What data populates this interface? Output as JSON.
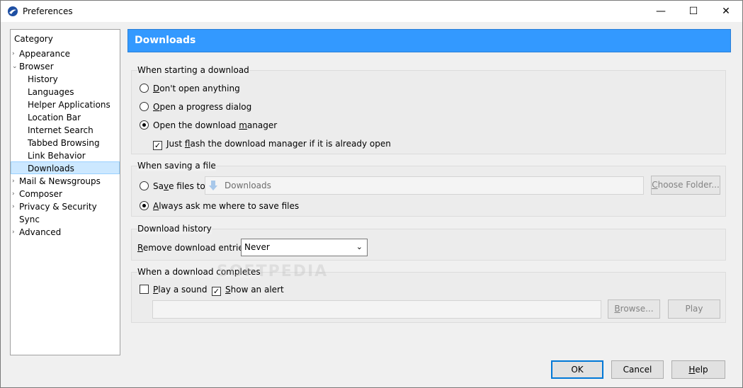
{
  "window": {
    "title": "Preferences",
    "minimize": "—",
    "maximize": "☐",
    "close": "✕"
  },
  "sidebar": {
    "header": "Category",
    "items": [
      {
        "label": "Appearance",
        "level": 0,
        "arrow": "›"
      },
      {
        "label": "Browser",
        "level": 0,
        "arrow": "⌄"
      },
      {
        "label": "History",
        "level": 1
      },
      {
        "label": "Languages",
        "level": 1
      },
      {
        "label": "Helper Applications",
        "level": 1
      },
      {
        "label": "Location Bar",
        "level": 1
      },
      {
        "label": "Internet Search",
        "level": 1
      },
      {
        "label": "Tabbed Browsing",
        "level": 1
      },
      {
        "label": "Link Behavior",
        "level": 1
      },
      {
        "label": "Downloads",
        "level": 1,
        "selected": true
      },
      {
        "label": "Mail & Newsgroups",
        "level": 0,
        "arrow": "›"
      },
      {
        "label": "Composer",
        "level": 0,
        "arrow": "›"
      },
      {
        "label": "Privacy & Security",
        "level": 0,
        "arrow": "›"
      },
      {
        "label": "Sync",
        "level": 0
      },
      {
        "label": "Advanced",
        "level": 0,
        "arrow": "›"
      }
    ]
  },
  "main": {
    "title": "Downloads",
    "starting": {
      "title": "When starting a download",
      "opt1_u": "D",
      "opt1_rest": "on't open anything",
      "opt2_u": "O",
      "opt2_rest": "pen a progress dialog",
      "opt3_pre": "Open the download ",
      "opt3_u": "m",
      "opt3_rest": "anager",
      "flash_pre": "Just ",
      "flash_u": "f",
      "flash_rest": "lash the download manager if it is already open",
      "selected": "open-download-manager",
      "flash_checked": true
    },
    "saving": {
      "title": "When saving a file",
      "save_pre": "Sa",
      "save_u": "v",
      "save_rest": "e files to",
      "folder": "Downloads",
      "choose_u": "C",
      "choose_rest": "hoose Folder...",
      "always_u": "A",
      "always_rest": "lways ask me where to save files",
      "selected": "always-ask"
    },
    "history": {
      "title": "Download history",
      "remove_u": "R",
      "remove_rest": "emove download entries",
      "value": "Never"
    },
    "completes": {
      "title": "When a download completes",
      "sound_u": "P",
      "sound_rest": "lay a sound",
      "sound_checked": false,
      "alert_u": "S",
      "alert_rest": "how an alert",
      "alert_checked": true,
      "browse_u": "B",
      "browse_rest": "rowse...",
      "play": "Play",
      "watermark": "SOFTPEDIA"
    }
  },
  "footer": {
    "ok": "OK",
    "cancel": "Cancel",
    "help_u": "H",
    "help_rest": "elp"
  },
  "colors": {
    "header_bg": "#3399ff",
    "selected_bg": "#cce8ff"
  }
}
